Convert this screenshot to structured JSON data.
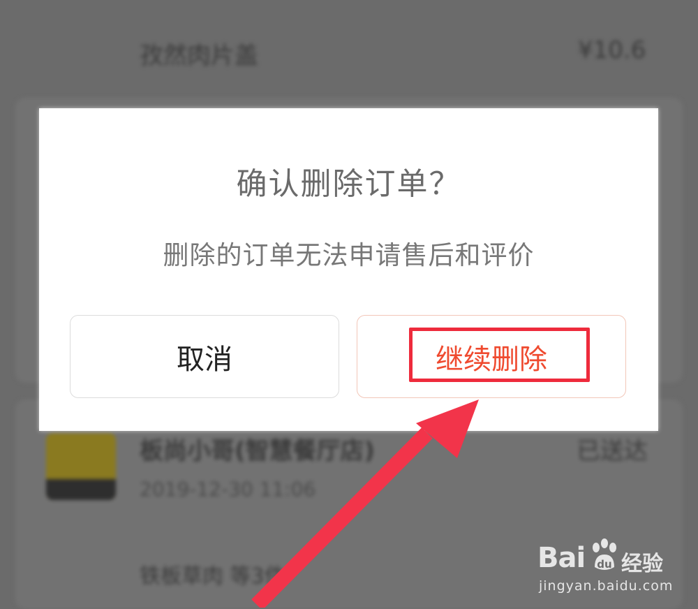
{
  "background": {
    "top_item_name": "孜然肉片盖",
    "top_item_price": "¥10.6",
    "store_name": "板尚小哥(智慧餐厅店)",
    "order_status": "已送达",
    "order_time": "2019-12-30 11:06",
    "item_name": "铁板草肉  等3件"
  },
  "dialog": {
    "title": "确认删除订单？",
    "message": "删除的订单无法申请售后和评价",
    "cancel_label": "取消",
    "confirm_label": "继续删除"
  },
  "watermark": {
    "logo_text": "Bai",
    "logo_suffix": "经验",
    "url": "jingyan.baidu.com"
  },
  "colors": {
    "overlay": "#6b6b6b",
    "confirm_text": "#ef4a2f",
    "highlight_box": "#ee2b3c",
    "arrow": "#f2344a"
  }
}
